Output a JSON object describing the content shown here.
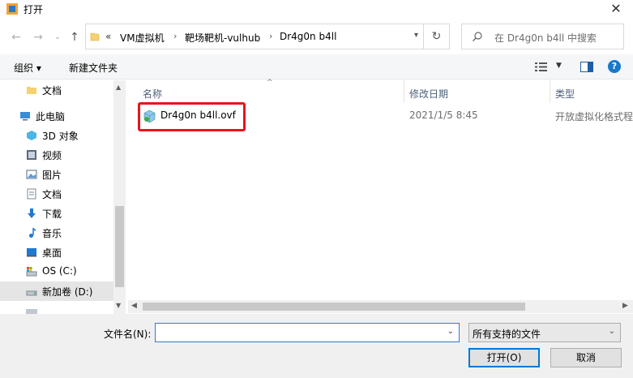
{
  "window": {
    "title": "打开",
    "close_glyph": "✕"
  },
  "nav": {
    "back_glyph": "←",
    "forward_glyph": "→",
    "recent_glyph": "⌄",
    "up_glyph": "↑",
    "overflow": "«",
    "breadcrumbs": [
      "VM虚拟机",
      "靶场靶机-vulhub",
      "Dr4g0n b4ll"
    ],
    "separator": "›",
    "refresh_glyph": "↻",
    "search_placeholder": "在 Dr4g0n b4ll 中搜索"
  },
  "toolbar": {
    "organize": "组织 ▾",
    "new_folder": "新建文件夹",
    "view_dd": "▼",
    "help": "?"
  },
  "sidebar": {
    "items": [
      {
        "label": "文档",
        "icon": "folder-icon"
      },
      {
        "label": "此电脑",
        "icon": "computer-icon"
      },
      {
        "label": "3D 对象",
        "icon": "3d-objects-icon"
      },
      {
        "label": "视频",
        "icon": "video-icon"
      },
      {
        "label": "图片",
        "icon": "pictures-icon"
      },
      {
        "label": "文档",
        "icon": "documents-icon"
      },
      {
        "label": "下载",
        "icon": "download-icon"
      },
      {
        "label": "音乐",
        "icon": "music-icon"
      },
      {
        "label": "桌面",
        "icon": "desktop-icon"
      },
      {
        "label": "OS (C:)",
        "icon": "drive-c-icon"
      },
      {
        "label": "新加卷 (D:)",
        "icon": "drive-d-icon"
      }
    ],
    "selected_index": 10
  },
  "columns": {
    "name": "名称",
    "date": "修改日期",
    "type": "类型",
    "sort_glyph": "^"
  },
  "files": [
    {
      "name": "Dr4g0n b4ll.ovf",
      "date": "2021/1/5 8:45",
      "type": "开放虚拟化格式程"
    }
  ],
  "bottom": {
    "filename_label": "文件名(N):",
    "filename_value": "",
    "filter_value": "所有支持的文件",
    "open_button": "打开(O)",
    "cancel_button": "取消"
  },
  "colors": {
    "highlight": "#e8141b",
    "accent": "#0078d7",
    "header_text": "#4c607a"
  }
}
